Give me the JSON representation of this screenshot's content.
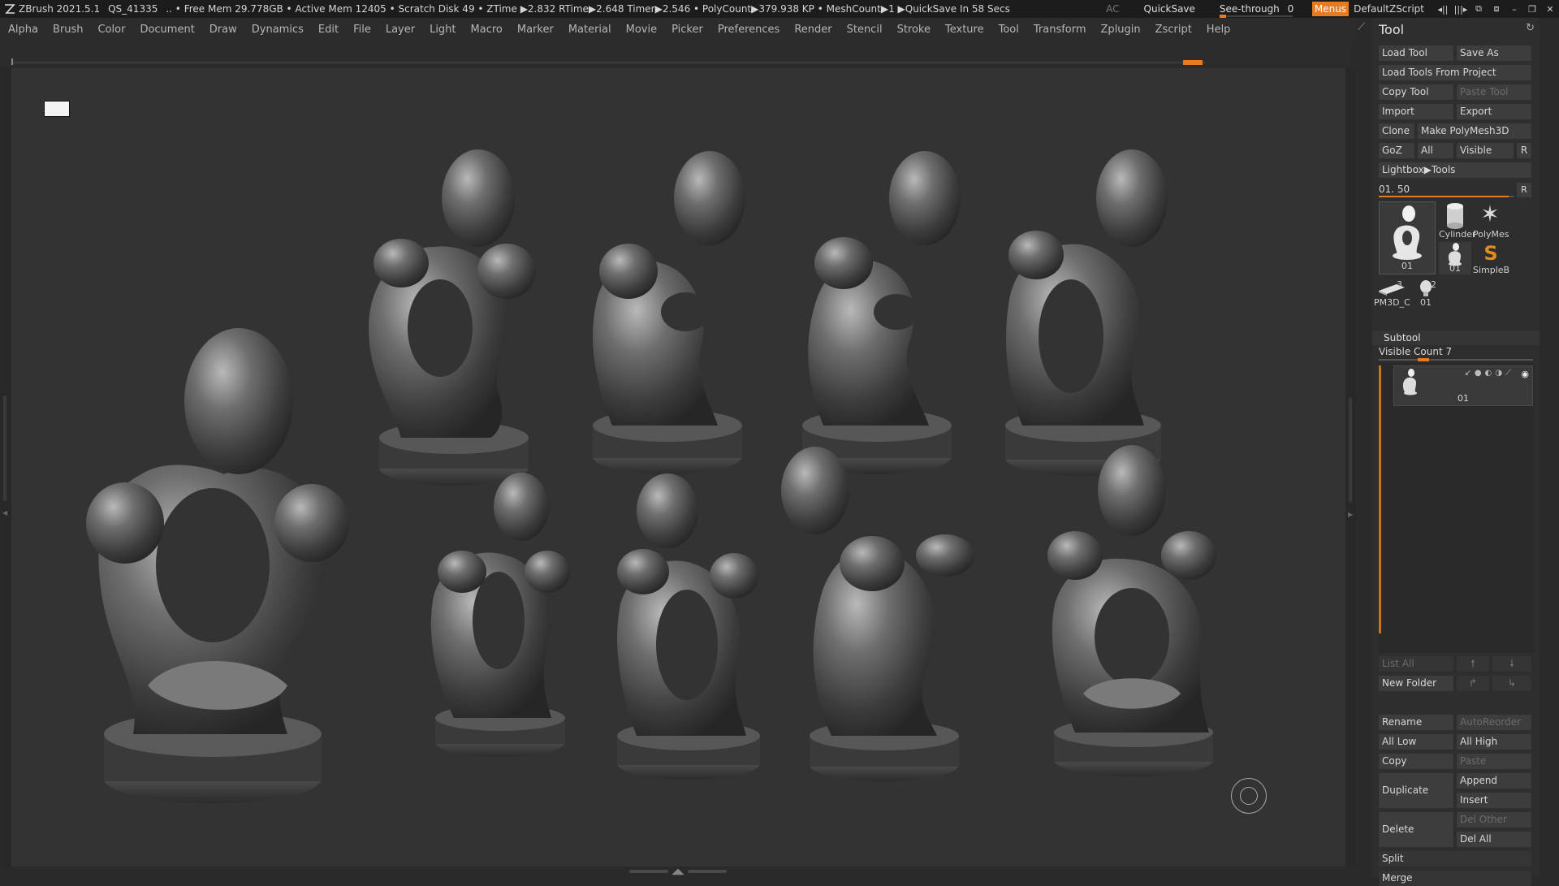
{
  "titlebar": {
    "app": "ZBrush 2021.5.1",
    "doc": "QS_41335",
    "stats": ".. • Free Mem 29.778GB • Active Mem 12405 • Scratch Disk 49 • ZTime ▶2.832 RTime▶2.648 Timer▶2.546 • PolyCount▶379.938 KP • MeshCount▶1 ▶QuickSave In 58 Secs",
    "ac": "AC",
    "quicksave": "QuickSave",
    "see_through_label": "See-through",
    "see_through_value": "0",
    "see_through_level": 0,
    "menus": "Menus",
    "script": "DefaultZScript",
    "accent_color": "#e77b22"
  },
  "menubar": {
    "items": [
      "Alpha",
      "Brush",
      "Color",
      "Document",
      "Draw",
      "Dynamics",
      "Edit",
      "File",
      "Layer",
      "Light",
      "Macro",
      "Marker",
      "Material",
      "Movie",
      "Picker",
      "Preferences",
      "Render",
      "Stencil",
      "Stroke",
      "Texture",
      "Tool",
      "Transform",
      "Zplugin",
      "Zscript",
      "Help"
    ]
  },
  "tool": {
    "title": "Tool",
    "load_tool": "Load Tool",
    "save_as": "Save As",
    "load_from_project": "Load Tools From Project",
    "copy_tool": "Copy Tool",
    "paste_tool": "Paste Tool",
    "import": "Import",
    "export": "Export",
    "clone": "Clone",
    "make_polymesh": "Make PolyMesh3D",
    "goz": "GoZ",
    "all": "All",
    "visible": "Visible",
    "r": "R",
    "lightbox": "Lightbox▶Tools",
    "slider_label": "01. 50",
    "slider_r": "R",
    "thumbs": {
      "main_label": "01",
      "cylinder": "Cylinder",
      "polymesh": "PolyMes",
      "small01": "01",
      "simpleb": "SimpleB",
      "pm3d": "PM3D_C",
      "pm3d_count": "3",
      "head01": "01",
      "head_count": "2"
    }
  },
  "subtool": {
    "title": "Subtool",
    "visible_count": "Visible Count 7",
    "item_name": "01",
    "list_all": "List All",
    "new_folder": "New Folder",
    "rename": "Rename",
    "auto_reorder": "AutoReorder",
    "all_low": "All Low",
    "all_high": "All High",
    "copy": "Copy",
    "paste": "Paste",
    "duplicate": "Duplicate",
    "append": "Append",
    "insert": "Insert",
    "delete": "Delete",
    "del_other": "Del Other",
    "del_all": "Del All",
    "split": "Split",
    "merge": "Merge"
  },
  "icons": {
    "pin": "pin-icon",
    "refresh": "refresh-icon",
    "logo": "zbrush-logo-icon",
    "minimize": "minimize-icon",
    "maximize": "maximize-icon",
    "close": "close-icon"
  }
}
